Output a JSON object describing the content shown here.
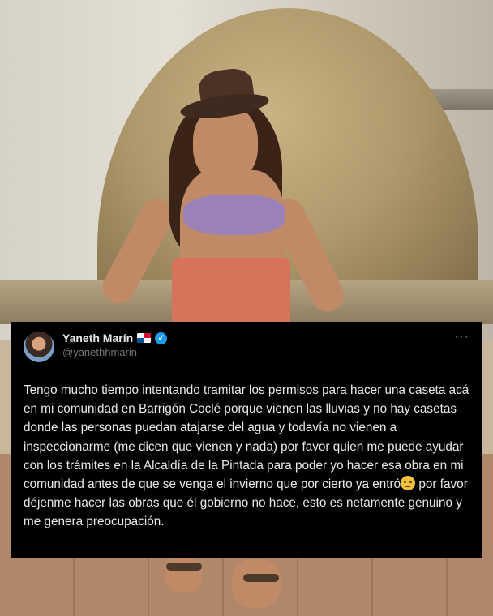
{
  "tweet": {
    "display_name": "Yaneth Marín",
    "handle": "@yanethhmarin",
    "flag_icon": "panama-flag-icon",
    "verified_icon": "verified-badge-icon",
    "more_icon": "more-options-icon",
    "text_before_emoji": "Tengo mucho tiempo intentando tramitar los permisos para hacer una caseta acá en mi comunidad en Barrigón Coclé porque vienen las lluvias y no hay casetas donde las personas puedan atajarse del agua y todavía no vienen a inspeccionarme (me dicen que vienen y nada) por favor quien me puede ayudar con los trámites en la Alcaldía de la Pintada para poder yo hacer esa obra en mi comunidad antes de que se venga el invierno que por cierto ya entró",
    "emoji": "disappointed-face-emoji",
    "text_after_emoji": " por favor déjenme hacer las obras que él gobierno no hace, esto es netamente genuino y me genera preocupación."
  },
  "colors": {
    "card_background": "#000000",
    "text_primary": "#e7e9ea",
    "text_secondary": "#71767b",
    "verified_blue": "#1d9bf0"
  }
}
